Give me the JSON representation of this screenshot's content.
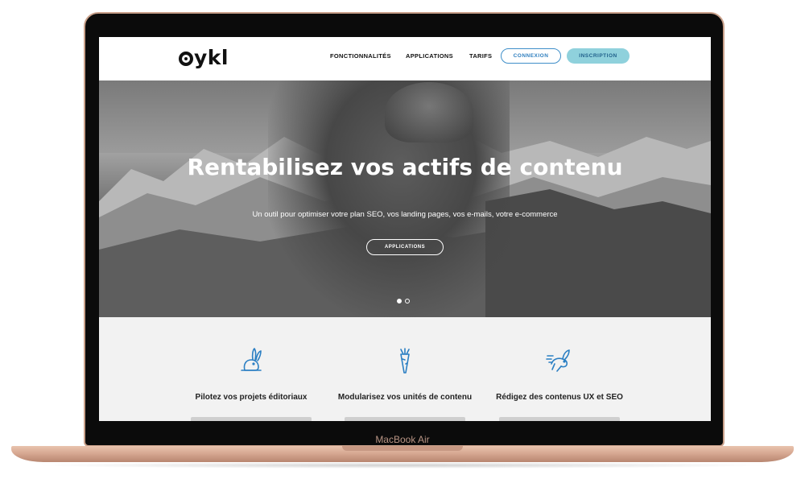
{
  "device": {
    "label": "MacBook Air"
  },
  "nav": {
    "logo": "ykl",
    "links": [
      "FONCTIONNALITÉS",
      "APPLICATIONS",
      "TARIFS"
    ],
    "login": "CONNEXION",
    "signup": "INSCRIPTION"
  },
  "hero": {
    "title": "Rentabilisez vos actifs de contenu",
    "subtitle": "Un outil pour optimiser votre plan SEO, vos landing pages, vos e-mails, votre e-commerce",
    "cta": "APPLICATIONS",
    "slides": {
      "count": 2,
      "active": 1
    }
  },
  "features": [
    {
      "icon": "rabbit-icon",
      "title": "Pilotez vos projets éditoriaux"
    },
    {
      "icon": "carrot-icon",
      "title": "Modularisez vos unités de contenu"
    },
    {
      "icon": "running-rabbit-icon",
      "title": "Rédigez des contenus UX et SEO"
    }
  ],
  "colors": {
    "accent": "#3f8fc9",
    "signup_bg": "#8fd1dc",
    "frame": "#c9a08a"
  }
}
